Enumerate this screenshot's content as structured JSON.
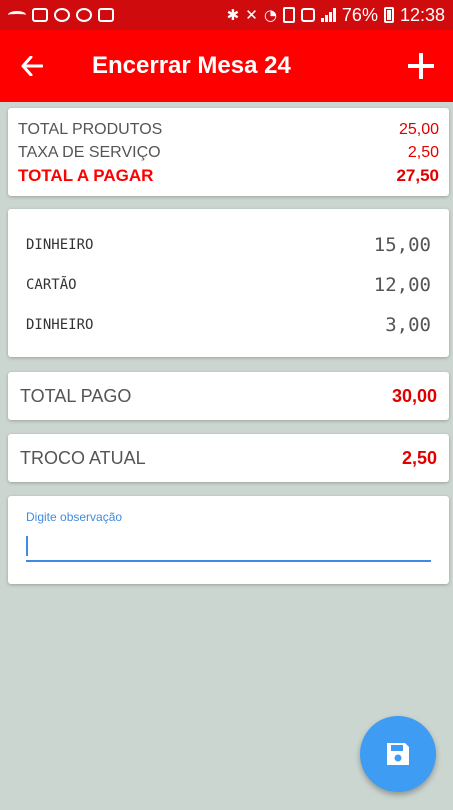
{
  "status_bar": {
    "battery": "76%",
    "time": "12:38"
  },
  "app_bar": {
    "title": "Encerrar Mesa 24"
  },
  "summary": {
    "rows": [
      {
        "label": "TOTAL PRODUTOS",
        "value": "25,00"
      },
      {
        "label": "TAXA DE SERVIÇO",
        "value": "2,50"
      },
      {
        "label": "TOTAL A PAGAR",
        "value": "27,50"
      }
    ]
  },
  "payments": [
    {
      "method": "DINHEIRO",
      "value": "15,00"
    },
    {
      "method": "CARTÃO",
      "value": "12,00"
    },
    {
      "method": "DINHEIRO",
      "value": "3,00"
    }
  ],
  "total_pago": {
    "label": "TOTAL PAGO",
    "value": "30,00"
  },
  "troco": {
    "label": "TROCO ATUAL",
    "value": "2,50"
  },
  "observation": {
    "label": "Digite observação",
    "value": ""
  },
  "colors": {
    "status_bar": "#cf0b0e",
    "app_bar": "#ff0000",
    "accent_red": "#e00000",
    "accent_blue": "#3f8be0",
    "fab": "#3e9cf2",
    "background": "#ccd6d0"
  },
  "icons": {
    "back": "arrow-left-icon",
    "add": "plus-icon",
    "fab": "floppy-disk-icon"
  }
}
